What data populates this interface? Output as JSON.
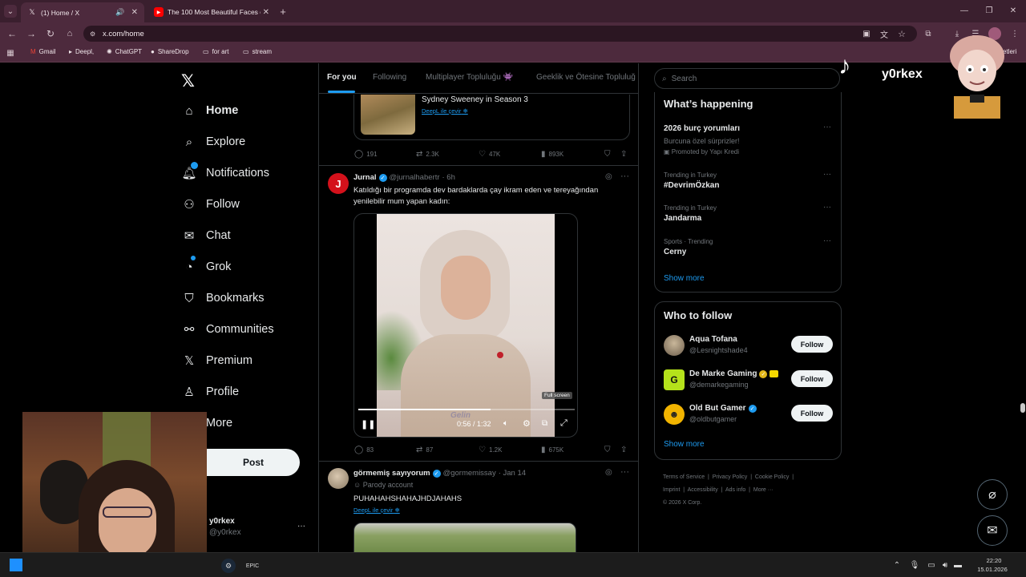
{
  "browser": {
    "tabs": [
      {
        "title": "(1) Home / X",
        "active": true
      },
      {
        "title": "The 100 Most Beautiful Faces o",
        "active": false
      }
    ],
    "url": "x.com/home",
    "bookmarks": [
      "Gmail",
      "Deepl,",
      "ChatGPT",
      "ShareDrop",
      "for art",
      "stream"
    ],
    "settings_cut": "etleri"
  },
  "nav": {
    "items": [
      "Home",
      "Explore",
      "Notifications",
      "Follow",
      "Chat",
      "Grok",
      "Bookmarks",
      "Communities",
      "Premium",
      "Profile",
      "More"
    ],
    "post_label": "Post",
    "account_name": "y0rkex",
    "account_handle": "@y0rkex",
    "account_more": "···"
  },
  "feed": {
    "tabs": [
      "For you",
      "Following",
      "Multiplayer Topluluğu 👾",
      "Geeklik ve Ötesine Topluluğ"
    ],
    "post1": {
      "title": "Sydney Sweeney in Season 3",
      "translate": "DeepL ile çevir",
      "replies": "191",
      "reposts": "2.3K",
      "likes": "47K",
      "views": "893K"
    },
    "post2": {
      "avatar_letter": "J",
      "name": "Jurnal",
      "handle": "@jurnalhabertr",
      "time": "· 6h",
      "text_line1": "Katıldığı bir programda dev bardaklarda çay ikram eden ve tereyağından",
      "text_line2": "yenilebilir mum yapan kadın:",
      "video_time": "0:56 / 1:32",
      "tooltip": "Full screen",
      "video_watermark": "Gelin",
      "progress": 0.61,
      "replies": "83",
      "reposts": "87",
      "likes": "1.2K",
      "views": "675K"
    },
    "post3": {
      "name": "görmemiş sayıyorum",
      "handle": "@gormemissay",
      "time": "· Jan 14",
      "parody": "Parody account",
      "text": "PUHAHAHSHAHAJHDJAHAHS",
      "translate": "DeepL ile çevir"
    }
  },
  "sidebar": {
    "search_placeholder": "Search",
    "happening_title": "What’s happening",
    "trends": [
      {
        "meta": "",
        "name": "2026 burç yorumları",
        "sub": "Burcuna özel sürprizler!",
        "promo": "Promoted by Yapı Kredi"
      },
      {
        "meta": "Trending in Turkey",
        "name": "#DevrimÖzkan"
      },
      {
        "meta": "Trending in Turkey",
        "name": "Jandarma"
      },
      {
        "meta": "Sports · Trending",
        "name": "Cerny"
      }
    ],
    "show_more": "Show more",
    "who_title": "Who to follow",
    "who": [
      {
        "name": "Aqua Tofana",
        "handle": "@Lesnightshade4",
        "btn": "Follow"
      },
      {
        "name": "De Marke Gaming",
        "handle": "@demarkegaming",
        "btn": "Follow"
      },
      {
        "name": "Old But Gamer",
        "handle": "@oldbutgamer",
        "btn": "Follow"
      }
    ],
    "footer": [
      "Terms of Service",
      "Privacy Policy",
      "Cookie Policy",
      "Imprint",
      "Accessibility",
      "Ads info",
      "More ···",
      "© 2026 X Corp."
    ]
  },
  "overlay": {
    "tiktok_name": "y0rkex"
  },
  "taskbar": {
    "time": "22:20",
    "date": "15.01.2026"
  }
}
